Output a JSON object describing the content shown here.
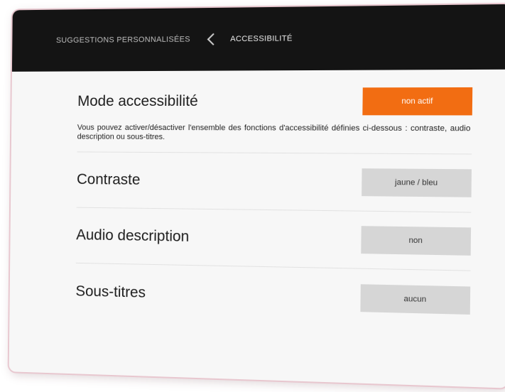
{
  "header": {
    "parent_label": "SUGGESTIONS PERSONNALISÉES",
    "current_label": "ACCESSIBILITÉ"
  },
  "accessibility_mode": {
    "title": "Mode accessibilité",
    "toggle_label": "non actif",
    "description": "Vous pouvez activer/désactiver l'ensemble des fonctions d'accessibilité définies ci-dessous : contraste, audio description ou sous-titres."
  },
  "settings": [
    {
      "label": "Contraste",
      "value": "jaune / bleu"
    },
    {
      "label": "Audio description",
      "value": "non"
    },
    {
      "label": "Sous-titres",
      "value": "aucun"
    }
  ],
  "colors": {
    "accent": "#f26d12",
    "header_bg": "#141414",
    "button_bg": "#d6d6d6"
  },
  "icons": {
    "back": "chevron-left-icon"
  }
}
